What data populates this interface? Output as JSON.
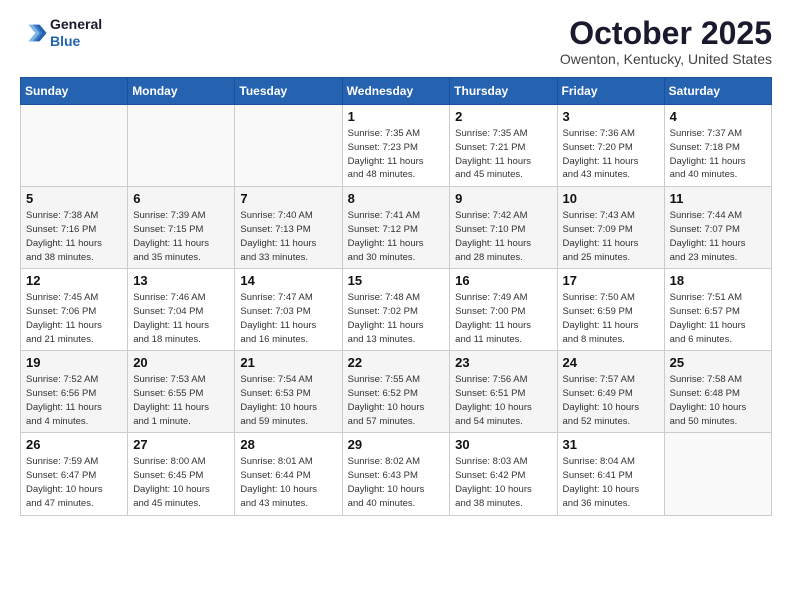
{
  "header": {
    "logo_line1": "General",
    "logo_line2": "Blue",
    "month": "October 2025",
    "location": "Owenton, Kentucky, United States"
  },
  "weekdays": [
    "Sunday",
    "Monday",
    "Tuesday",
    "Wednesday",
    "Thursday",
    "Friday",
    "Saturday"
  ],
  "weeks": [
    [
      {
        "day": "",
        "info": ""
      },
      {
        "day": "",
        "info": ""
      },
      {
        "day": "",
        "info": ""
      },
      {
        "day": "1",
        "info": "Sunrise: 7:35 AM\nSunset: 7:23 PM\nDaylight: 11 hours\nand 48 minutes."
      },
      {
        "day": "2",
        "info": "Sunrise: 7:35 AM\nSunset: 7:21 PM\nDaylight: 11 hours\nand 45 minutes."
      },
      {
        "day": "3",
        "info": "Sunrise: 7:36 AM\nSunset: 7:20 PM\nDaylight: 11 hours\nand 43 minutes."
      },
      {
        "day": "4",
        "info": "Sunrise: 7:37 AM\nSunset: 7:18 PM\nDaylight: 11 hours\nand 40 minutes."
      }
    ],
    [
      {
        "day": "5",
        "info": "Sunrise: 7:38 AM\nSunset: 7:16 PM\nDaylight: 11 hours\nand 38 minutes."
      },
      {
        "day": "6",
        "info": "Sunrise: 7:39 AM\nSunset: 7:15 PM\nDaylight: 11 hours\nand 35 minutes."
      },
      {
        "day": "7",
        "info": "Sunrise: 7:40 AM\nSunset: 7:13 PM\nDaylight: 11 hours\nand 33 minutes."
      },
      {
        "day": "8",
        "info": "Sunrise: 7:41 AM\nSunset: 7:12 PM\nDaylight: 11 hours\nand 30 minutes."
      },
      {
        "day": "9",
        "info": "Sunrise: 7:42 AM\nSunset: 7:10 PM\nDaylight: 11 hours\nand 28 minutes."
      },
      {
        "day": "10",
        "info": "Sunrise: 7:43 AM\nSunset: 7:09 PM\nDaylight: 11 hours\nand 25 minutes."
      },
      {
        "day": "11",
        "info": "Sunrise: 7:44 AM\nSunset: 7:07 PM\nDaylight: 11 hours\nand 23 minutes."
      }
    ],
    [
      {
        "day": "12",
        "info": "Sunrise: 7:45 AM\nSunset: 7:06 PM\nDaylight: 11 hours\nand 21 minutes."
      },
      {
        "day": "13",
        "info": "Sunrise: 7:46 AM\nSunset: 7:04 PM\nDaylight: 11 hours\nand 18 minutes."
      },
      {
        "day": "14",
        "info": "Sunrise: 7:47 AM\nSunset: 7:03 PM\nDaylight: 11 hours\nand 16 minutes."
      },
      {
        "day": "15",
        "info": "Sunrise: 7:48 AM\nSunset: 7:02 PM\nDaylight: 11 hours\nand 13 minutes."
      },
      {
        "day": "16",
        "info": "Sunrise: 7:49 AM\nSunset: 7:00 PM\nDaylight: 11 hours\nand 11 minutes."
      },
      {
        "day": "17",
        "info": "Sunrise: 7:50 AM\nSunset: 6:59 PM\nDaylight: 11 hours\nand 8 minutes."
      },
      {
        "day": "18",
        "info": "Sunrise: 7:51 AM\nSunset: 6:57 PM\nDaylight: 11 hours\nand 6 minutes."
      }
    ],
    [
      {
        "day": "19",
        "info": "Sunrise: 7:52 AM\nSunset: 6:56 PM\nDaylight: 11 hours\nand 4 minutes."
      },
      {
        "day": "20",
        "info": "Sunrise: 7:53 AM\nSunset: 6:55 PM\nDaylight: 11 hours\nand 1 minute."
      },
      {
        "day": "21",
        "info": "Sunrise: 7:54 AM\nSunset: 6:53 PM\nDaylight: 10 hours\nand 59 minutes."
      },
      {
        "day": "22",
        "info": "Sunrise: 7:55 AM\nSunset: 6:52 PM\nDaylight: 10 hours\nand 57 minutes."
      },
      {
        "day": "23",
        "info": "Sunrise: 7:56 AM\nSunset: 6:51 PM\nDaylight: 10 hours\nand 54 minutes."
      },
      {
        "day": "24",
        "info": "Sunrise: 7:57 AM\nSunset: 6:49 PM\nDaylight: 10 hours\nand 52 minutes."
      },
      {
        "day": "25",
        "info": "Sunrise: 7:58 AM\nSunset: 6:48 PM\nDaylight: 10 hours\nand 50 minutes."
      }
    ],
    [
      {
        "day": "26",
        "info": "Sunrise: 7:59 AM\nSunset: 6:47 PM\nDaylight: 10 hours\nand 47 minutes."
      },
      {
        "day": "27",
        "info": "Sunrise: 8:00 AM\nSunset: 6:45 PM\nDaylight: 10 hours\nand 45 minutes."
      },
      {
        "day": "28",
        "info": "Sunrise: 8:01 AM\nSunset: 6:44 PM\nDaylight: 10 hours\nand 43 minutes."
      },
      {
        "day": "29",
        "info": "Sunrise: 8:02 AM\nSunset: 6:43 PM\nDaylight: 10 hours\nand 40 minutes."
      },
      {
        "day": "30",
        "info": "Sunrise: 8:03 AM\nSunset: 6:42 PM\nDaylight: 10 hours\nand 38 minutes."
      },
      {
        "day": "31",
        "info": "Sunrise: 8:04 AM\nSunset: 6:41 PM\nDaylight: 10 hours\nand 36 minutes."
      },
      {
        "day": "",
        "info": ""
      }
    ]
  ]
}
